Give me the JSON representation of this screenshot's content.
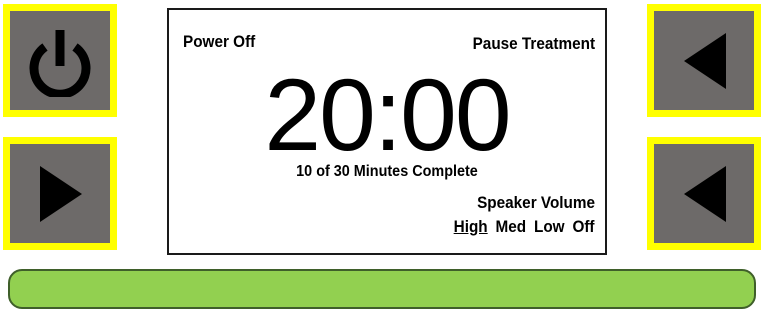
{
  "device": {
    "colors": {
      "button_face": "#6d6a69",
      "button_border": "#ffff00",
      "status_bar": "#92d050"
    }
  },
  "left_buttons": [
    {
      "icon": "power-icon"
    },
    {
      "icon": "play-icon"
    }
  ],
  "right_buttons": [
    {
      "icon": "triangle-left-icon"
    },
    {
      "icon": "triangle-left-icon"
    }
  ],
  "screen": {
    "power_off_label": "Power Off",
    "pause_label": "Pause Treatment",
    "timer": "20:00",
    "progress_text": "10 of 30 Minutes Complete",
    "volume_heading": "Speaker Volume",
    "volume_options": [
      "High",
      "Med",
      "Low",
      "Off"
    ],
    "volume_selected": "High"
  }
}
